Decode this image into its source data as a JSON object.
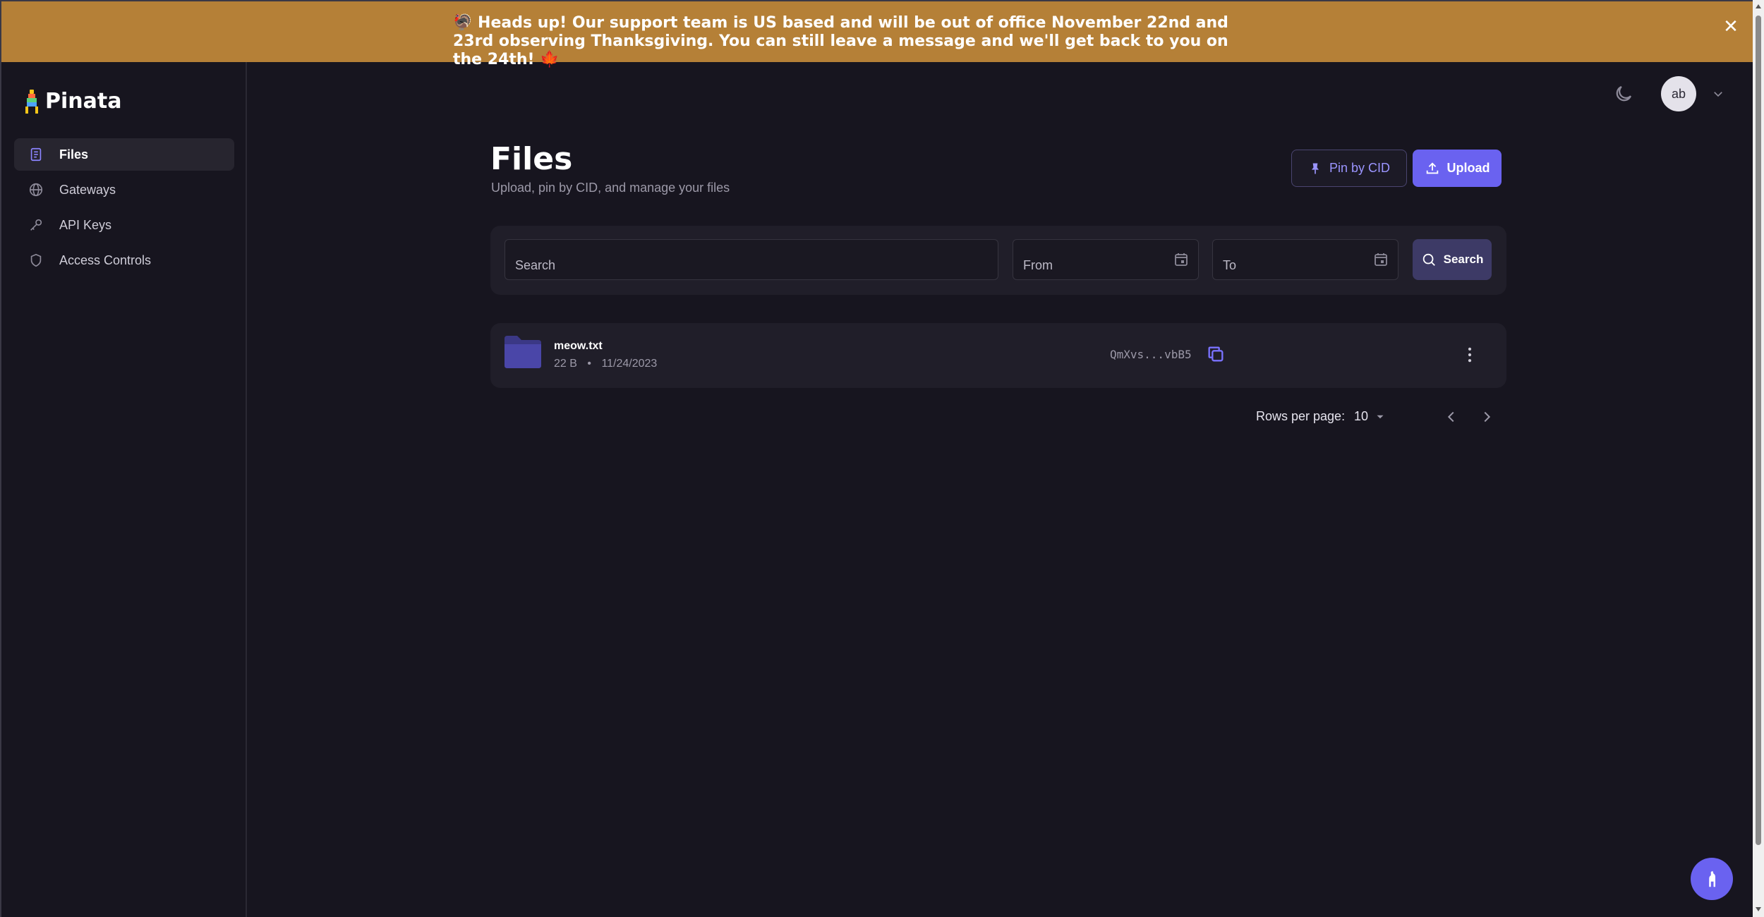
{
  "banner": {
    "text": "🦃 Heads up! Our support team is US based and will be out of office November 22nd and 23rd observing Thanksgiving. You can still leave a message and we'll get back to you on the 24th! 🍁",
    "close": "✕"
  },
  "brand": {
    "name": "Pinata"
  },
  "sidebar": {
    "items": [
      {
        "label": "Files",
        "icon": "file-icon",
        "active": true
      },
      {
        "label": "Gateways",
        "icon": "globe-icon"
      },
      {
        "label": "API Keys",
        "icon": "key-icon"
      },
      {
        "label": "Access Controls",
        "icon": "shield-icon"
      }
    ]
  },
  "header": {
    "avatar": "ab"
  },
  "main": {
    "title": "Files",
    "subtitle": "Upload, pin by CID, and manage your files",
    "pin_label": "Pin by CID",
    "upload_label": "Upload"
  },
  "filters": {
    "search_placeholder": "Search",
    "from_placeholder": "From",
    "to_placeholder": "To",
    "search_button": "Search"
  },
  "files": [
    {
      "name": "meow.txt",
      "size": "22 B",
      "separator": "•",
      "date": "11/24/2023",
      "cid": "QmXvs...vbB5"
    }
  ],
  "pagination": {
    "rows_label": "Rows per page:",
    "rows_value": "10"
  },
  "colors": {
    "accent": "#6a62f0",
    "banner": "#b58037",
    "background": "#17151f"
  }
}
